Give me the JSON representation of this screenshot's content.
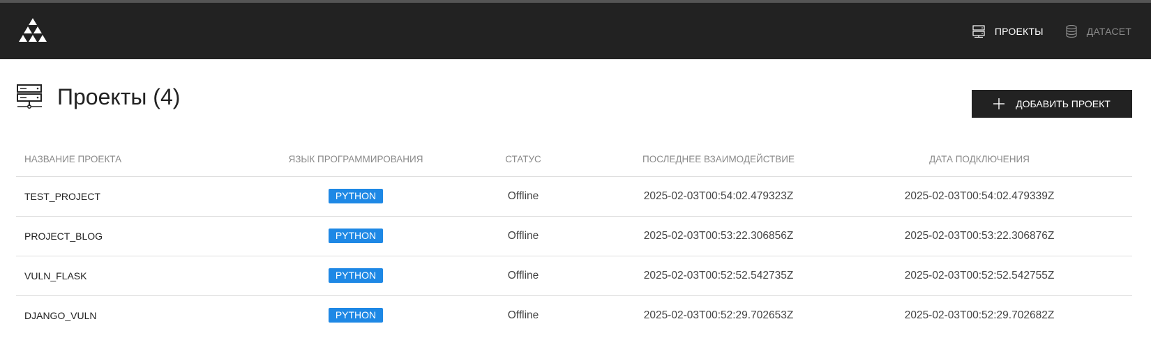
{
  "nav": {
    "items": [
      {
        "label": "ПРОЕКТЫ",
        "icon": "server-icon",
        "active": true
      },
      {
        "label": "ДАТАСЕТ",
        "icon": "database-icon",
        "active": false
      }
    ]
  },
  "header": {
    "title": "Проекты (4)",
    "icon": "server-network-icon"
  },
  "toolbar": {
    "add_label": "ДОБАВИТЬ ПРОЕКТ"
  },
  "table": {
    "columns": [
      "НАЗВАНИЕ ПРОЕКТА",
      "ЯЗЫК ПРОГРАММИРОВАНИЯ",
      "СТАТУС",
      "ПОСЛЕДНЕЕ ВЗАИМОДЕЙСТВИЕ",
      "ДАТА ПОДКЛЮЧЕНИЯ"
    ],
    "rows": [
      {
        "name": "TEST_PROJECT",
        "language": "PYTHON",
        "status": "Offline",
        "last_interaction": "2025-02-03T00:54:02.479323Z",
        "connected": "2025-02-03T00:54:02.479339Z"
      },
      {
        "name": "PROJECT_BLOG",
        "language": "PYTHON",
        "status": "Offline",
        "last_interaction": "2025-02-03T00:53:22.306856Z",
        "connected": "2025-02-03T00:53:22.306876Z"
      },
      {
        "name": "VULN_FLASK",
        "language": "PYTHON",
        "status": "Offline",
        "last_interaction": "2025-02-03T00:52:52.542735Z",
        "connected": "2025-02-03T00:52:52.542755Z"
      },
      {
        "name": "DJANGO_VULN",
        "language": "PYTHON",
        "status": "Offline",
        "last_interaction": "2025-02-03T00:52:29.702653Z",
        "connected": "2025-02-03T00:52:29.702682Z"
      }
    ]
  },
  "colors": {
    "topbar": "#222222",
    "badge": "#1e88e5",
    "button": "#222222"
  }
}
